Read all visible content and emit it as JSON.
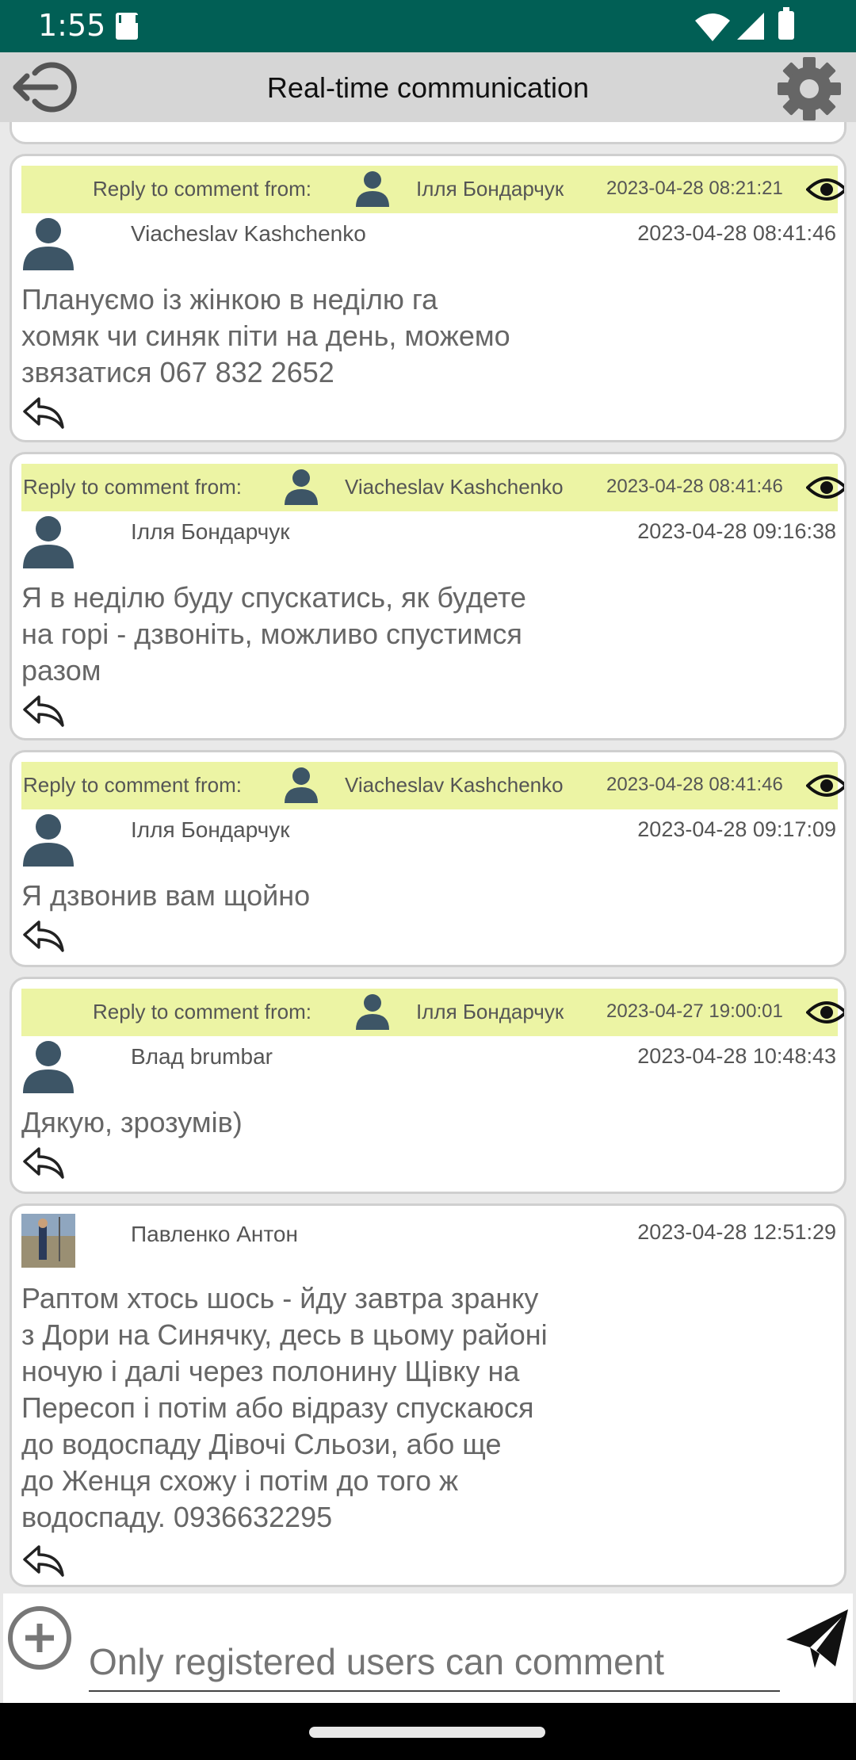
{
  "status": {
    "time": "1:55"
  },
  "appbar": {
    "title": "Real-time communication"
  },
  "comments": [
    {
      "reply": {
        "label": "Reply to comment from:",
        "name": "Ілля Бондарчук",
        "date": "2023-04-28 08:21:21"
      },
      "author": "Viacheslav Kashchenko",
      "date": "2023-04-28 08:41:46",
      "lines": [
        "Плануємо із жінкою в неділю га",
        "хомяк чи синяк піти на день, можемо",
        "звязатися 067 832 2652"
      ]
    },
    {
      "reply": {
        "label": "Reply to comment from:",
        "name": "Viacheslav Kashchenko",
        "date": "2023-04-28 08:41:46"
      },
      "author": "Ілля Бондарчук",
      "date": "2023-04-28 09:16:38",
      "lines": [
        "Я в неділю буду спускатись, як будете",
        "на горі - дзвоніть, можливо спустимся",
        "разом"
      ]
    },
    {
      "reply": {
        "label": "Reply to comment from:",
        "name": "Viacheslav Kashchenko",
        "date": "2023-04-28 08:41:46"
      },
      "author": "Ілля Бондарчук",
      "date": "2023-04-28 09:17:09",
      "lines": [
        "Я дзвонив вам щойно"
      ]
    },
    {
      "reply": {
        "label": "Reply to comment from:",
        "name": "Ілля Бондарчук",
        "date": "2023-04-27 19:00:01"
      },
      "author": "Влад brumbar",
      "date": "2023-04-28 10:48:43",
      "lines": [
        "Дякую, зрозумів)"
      ]
    },
    {
      "author": "Павленко Антон",
      "date": "2023-04-28 12:51:29",
      "lines": [
        "Раптом хтось шось - йду завтра зранку",
        "з Дори на Синячку, десь в цьому районі",
        "ночую і далі через полонину Щівку на",
        "Пересоп і потім або відразу спускаюся",
        "до водоспаду Дівочі Сльози, або ще",
        "до Женця схожу і потім до того ж",
        "водоспаду. 0936632295"
      ]
    }
  ],
  "composer": {
    "placeholder": "Only registered users can comment"
  },
  "colors": {
    "status_bar": "#015f55",
    "reply_highlight": "#ecf4a4",
    "app_bar": "#d6d6d6"
  },
  "icons": [
    "back-icon",
    "gear-icon",
    "person-icon",
    "eye-icon",
    "reply-icon",
    "add-icon",
    "send-icon"
  ]
}
